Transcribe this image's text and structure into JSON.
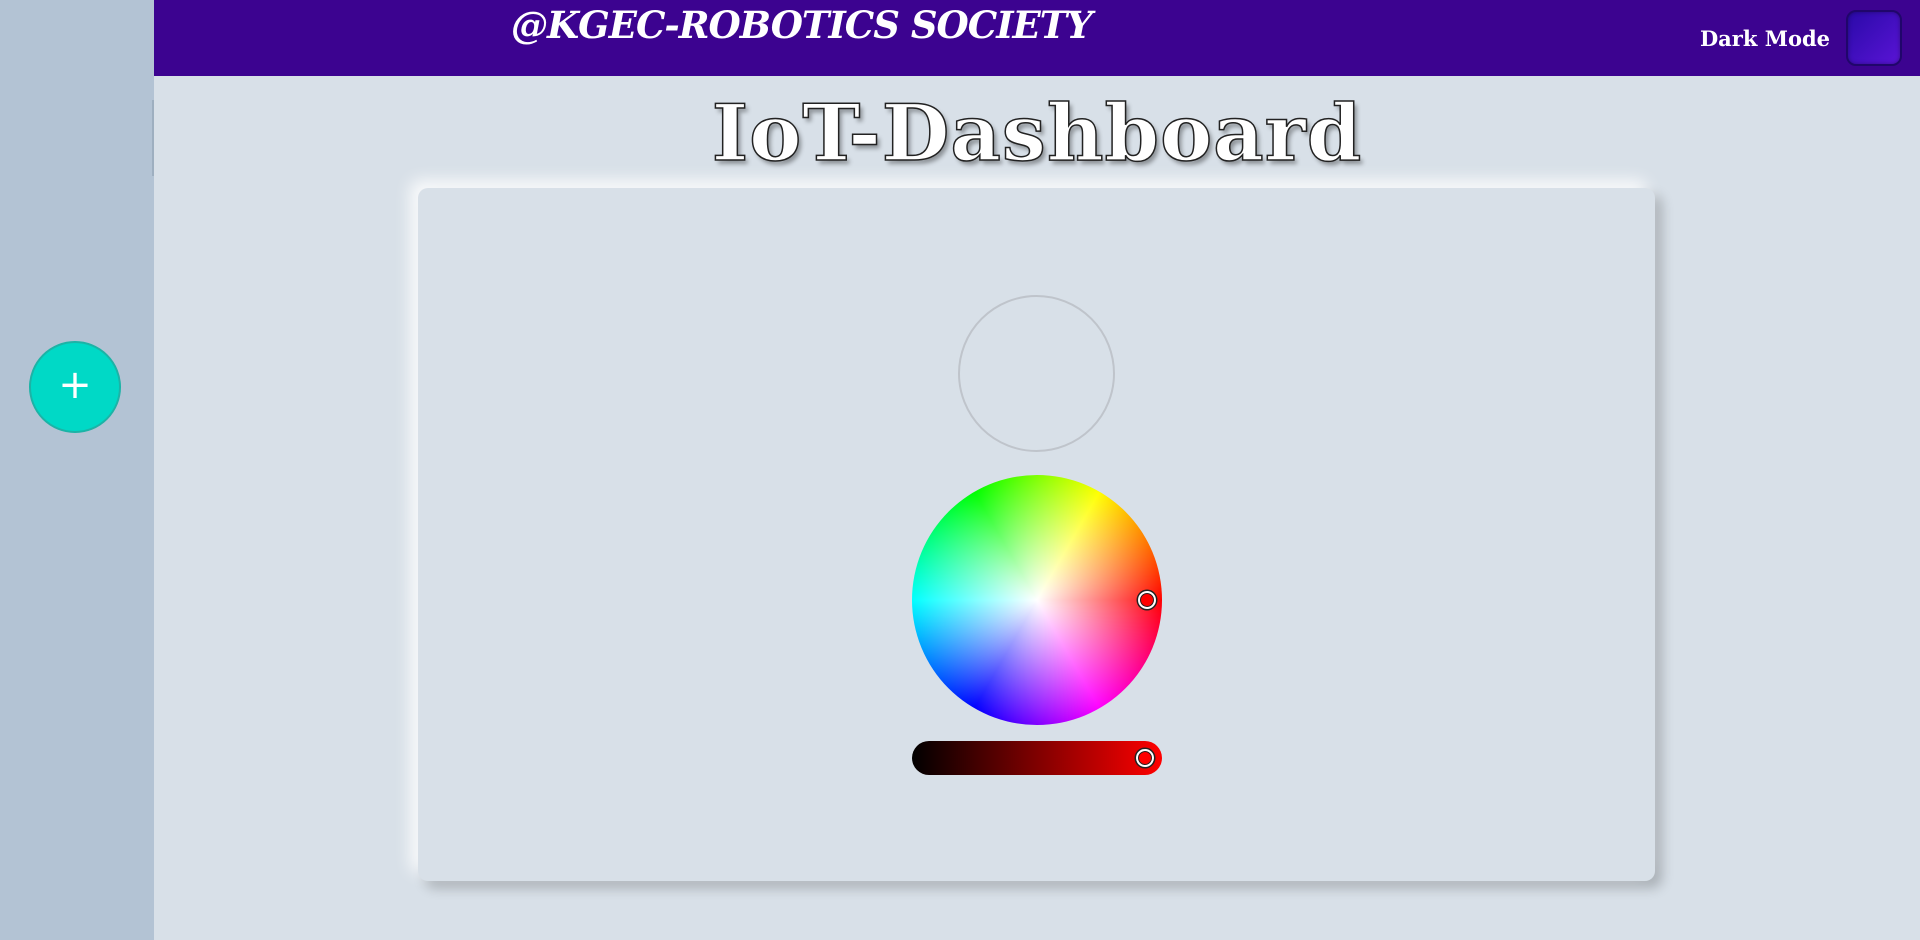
{
  "header": {
    "title": "@KGEC-ROBOTICS SOCIETY",
    "dark_mode_label": "Dark Mode",
    "background_color": "#3c0390"
  },
  "sidebar": {
    "add_button_label": "+",
    "add_button_color": "#00d9c6"
  },
  "main": {
    "title": "IoT-Dashboard"
  },
  "color_picker": {
    "selected_color": "#ff0000",
    "hue_degrees": 0,
    "saturation": 0.88,
    "brightness": 0.93
  }
}
